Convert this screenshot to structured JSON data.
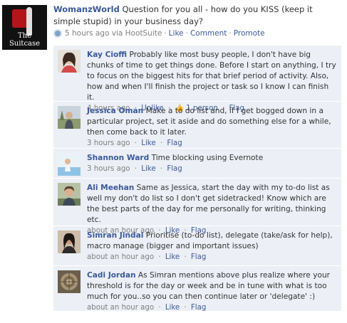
{
  "post": {
    "page_name": "WomanzWorld",
    "message": "Question for you all - how do you KISS (keep it simple stupid) in your business day?",
    "time": "5 hours ago via HootSuite",
    "actions": [
      "Like",
      "Comment",
      "Promote"
    ],
    "avatar_logo_text": "The Suitcase"
  },
  "comments": [
    {
      "name": "Kay Cioffi",
      "text": "Probably like most busy people, I don't have big chunks of time to get things done. Before I start on anything, I try to focus on the biggest hits for that brief period of activity. Also, how and when I'll finish the project or task so I know I can finish it.",
      "time": "4 hours ago",
      "actions": [
        "Unlike"
      ],
      "likes": "1 person",
      "flag": "Flag",
      "avatar_color": "#8a6a55"
    },
    {
      "name": "Jessica Oman",
      "text": "Make a to do list and, if I get bogged down in a particular project, set it aside and do something else for a while, then come back to it later.",
      "time": "3 hours ago",
      "actions": [
        "Like"
      ],
      "flag": "Flag",
      "avatar_color": "#9aa38a"
    },
    {
      "name": "Shannon Ward",
      "text": "Time blocking using Evernote",
      "time": "3 hours ago",
      "actions": [
        "Like"
      ],
      "flag": "Flag",
      "avatar_color": "#b9d6ec"
    },
    {
      "name": "Ali Meehan",
      "text": "Same as Jessica, start the day with my to-do list as well my don't do list so I don't get sidetracked! Know which are the best parts of the day for me personally for writing, thinking etc.",
      "time": "about an hour ago",
      "actions": [
        "Like"
      ],
      "flag": "Flag",
      "avatar_color": "#7d8a6a"
    },
    {
      "name": "Simran Jindal",
      "text": "Prioritise (to-do list), delegate (take/ask for help), macro manage (bigger and important issues)",
      "time": "about an hour ago",
      "actions": [
        "Like"
      ],
      "flag": "Flag",
      "avatar_color": "#5a4a3e"
    },
    {
      "name": "Cadi Jordan",
      "text": "As Simran mentions above plus realize where your threshold is for the day or week and be in tune with what is too much for you..so you can then continue later or 'delegate' :)",
      "time": "about an hour ago",
      "actions": [
        "Like"
      ],
      "flag": "Flag",
      "avatar_color": "#8b7a63"
    }
  ]
}
